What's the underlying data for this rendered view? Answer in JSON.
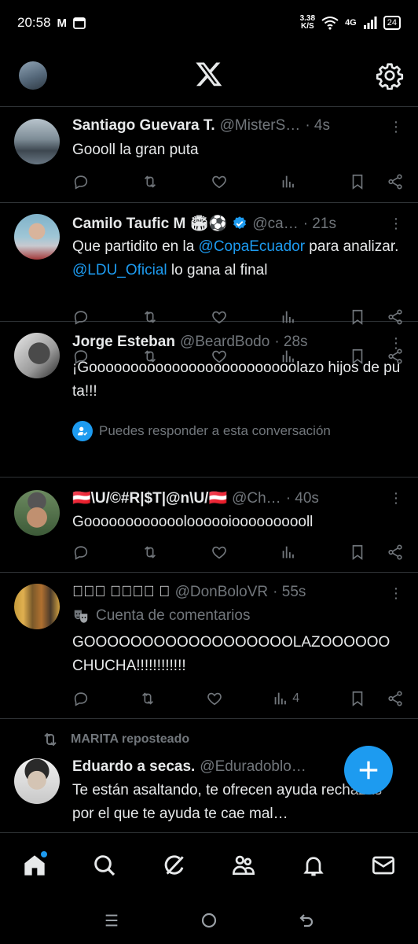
{
  "status_bar": {
    "time": "20:58",
    "net_speed_value": "3.38",
    "net_speed_unit": "K/S",
    "network": "4G",
    "battery": "24"
  },
  "colors": {
    "accent": "#1d9bf0",
    "muted": "#71767b",
    "text": "#e7e9ea",
    "divider": "#2f3336"
  },
  "tweets": [
    {
      "name": "Santiago Guevara T.",
      "handle": "@MisterS…",
      "time": "· 4s",
      "text": "Goooll la gran puta"
    },
    {
      "name": "Camilo Taufic M 🏟⚽",
      "handle": "@ca…",
      "time": "· 21s",
      "text_1": "Que partidito en la ",
      "mention_1": "@CopaEcuador",
      "text_2": " para analizar. ",
      "mention_2": "@LDU_Oficial",
      "text_3": " lo gana al final"
    },
    {
      "name": "Jorge Esteban",
      "handle": "@BeardBodo",
      "time": "· 28s",
      "text": "¡Gooooooooooooooooooooooooolazo hijos de puta!!!",
      "reply_note": "Puedes responder a esta conversación"
    },
    {
      "name": "🇦🇹\\U/©#R|$T|@n\\U/🇦🇹",
      "handle": "@Ch…",
      "time": "· 40s",
      "text": "Gooooooooooooloooooioooooooooll"
    },
    {
      "name": "ⒹⓄⓃ ⒷⓄⓁⓄ ",
      "handle": "@DonBoloVR",
      "time": "· 55s",
      "label": "Cuenta de comentarios",
      "text": "GOOOOOOOOOOOOOOOOOOLAZOOOOOO CHUCHA!!!!!!!!!!!!",
      "views": "4"
    },
    {
      "repost_by": "MARITA reposteado",
      "name": "Eduardo a secas.",
      "handle": "@Eduradoblo…",
      "text": "Te están asaltando, te ofrecen ayuda rechazas por el que te ayuda te cae mal…"
    }
  ],
  "icons": {
    "header": [
      "avatar",
      "x-logo-icon",
      "gear-icon"
    ],
    "actions": [
      "reply-icon",
      "repost-icon",
      "like-icon",
      "views-icon",
      "bookmark-icon",
      "share-icon"
    ],
    "bottom_nav": [
      "home-icon",
      "search-icon",
      "grok-icon",
      "communities-icon",
      "notifications-icon",
      "messages-icon"
    ],
    "fab": "plus-icon"
  }
}
